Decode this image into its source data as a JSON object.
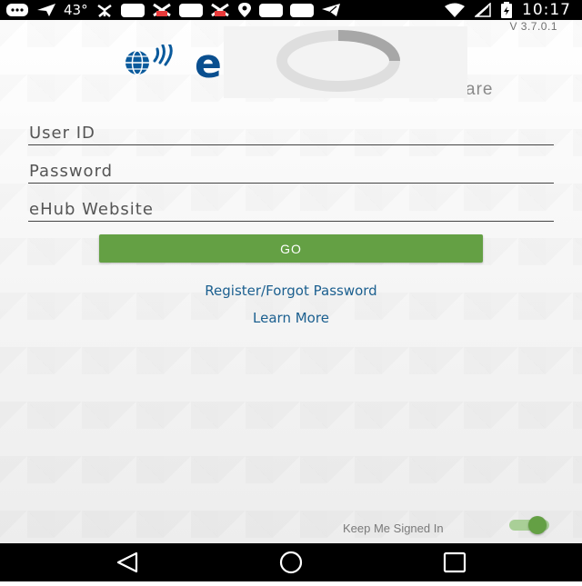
{
  "status_bar": {
    "temperature": "43°",
    "time": "10:17",
    "icons": [
      "message-icon",
      "send-icon",
      "weather-icon",
      "app-icon",
      "notification-icon",
      "app-icon",
      "notification-icon",
      "location-icon",
      "app-icon",
      "app-icon",
      "telegram-icon",
      "wifi-icon",
      "signal-icon",
      "battery-icon"
    ]
  },
  "app": {
    "version": "V 3.7.0.1",
    "logo_letter": "e",
    "logo_tail": "are"
  },
  "form": {
    "user_id_placeholder": "User ID",
    "password_placeholder": "Password",
    "website_placeholder": "eHub Website",
    "go_label": "GO",
    "register_link": "Register/Forgot Password",
    "learn_more_link": "Learn More",
    "keep_signed_in_label": "Keep Me Signed In",
    "keep_signed_in": true
  },
  "colors": {
    "primary_green": "#64a044",
    "link_blue": "#1b5f8f",
    "logo_blue": "#0a4f8f"
  },
  "nav_bar": {
    "icons": [
      "back-icon",
      "home-icon",
      "recents-icon"
    ]
  }
}
